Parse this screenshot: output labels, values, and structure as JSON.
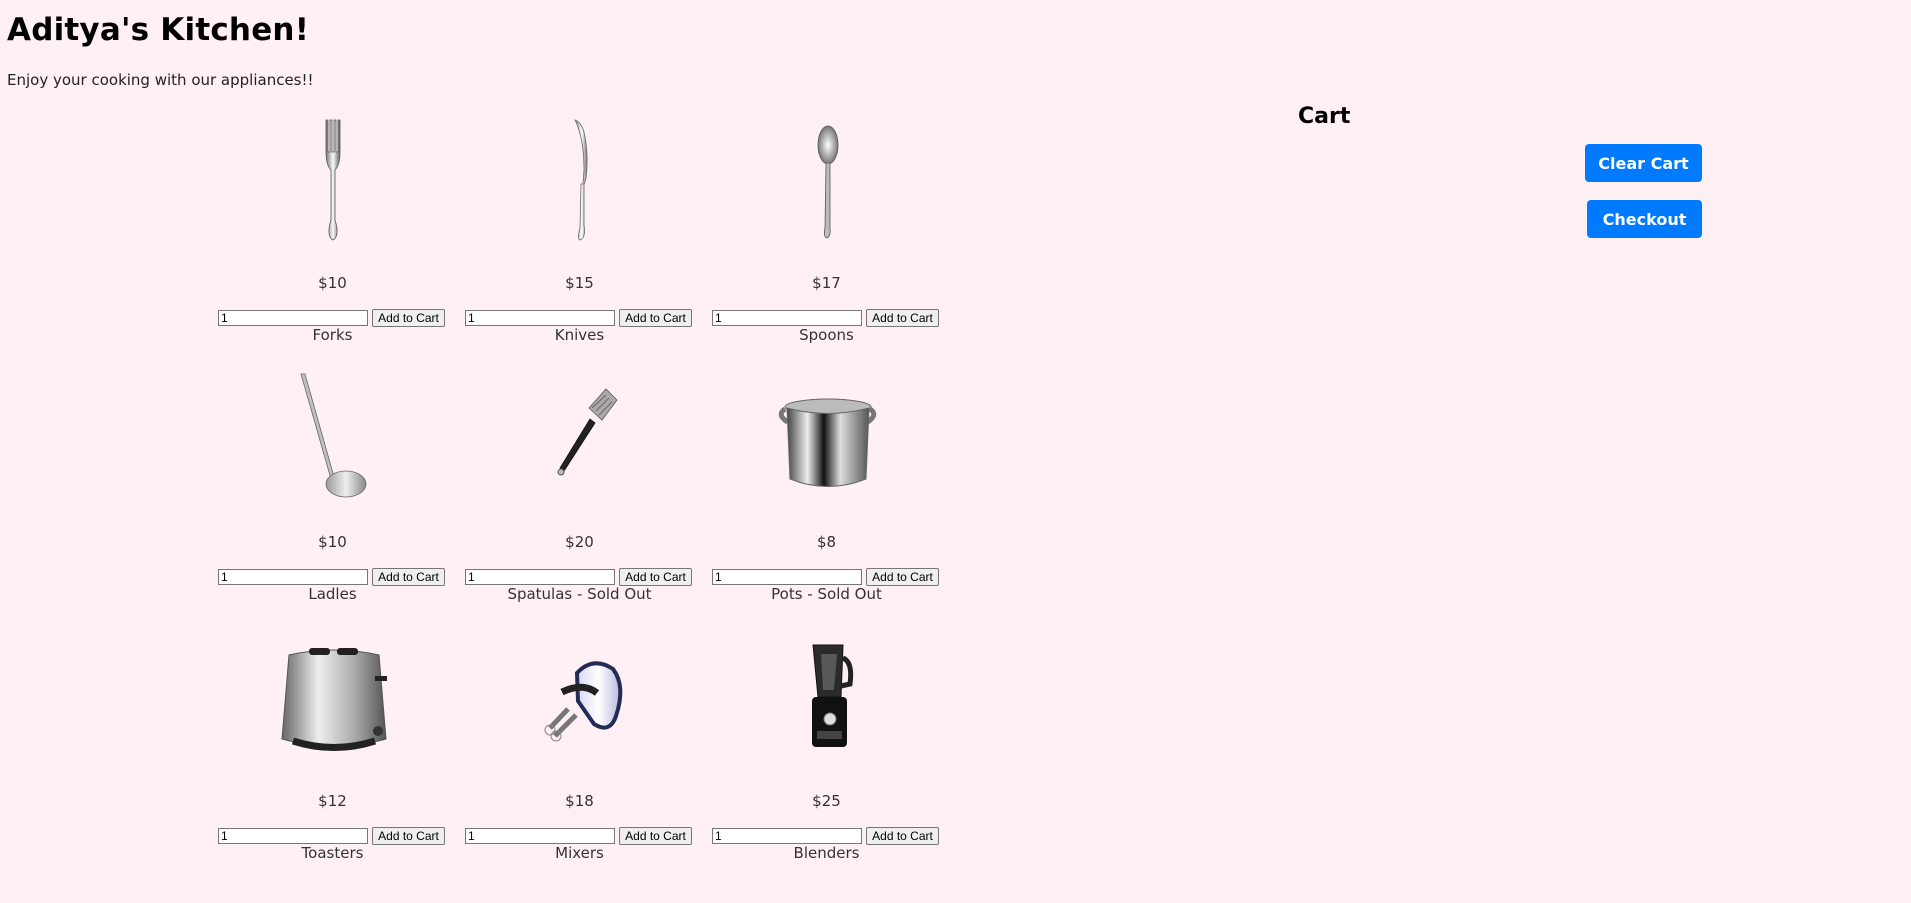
{
  "header": {
    "title": "Aditya's Kitchen!",
    "subtitle": "Enjoy your cooking with our appliances!!"
  },
  "products": [
    {
      "name": "Forks",
      "price": "$10",
      "quantity": "1",
      "button_label": "Add to Cart",
      "icon": "fork-icon"
    },
    {
      "name": "Knives",
      "price": "$15",
      "quantity": "1",
      "button_label": "Add to Cart",
      "icon": "knife-icon"
    },
    {
      "name": "Spoons",
      "price": "$17",
      "quantity": "1",
      "button_label": "Add to Cart",
      "icon": "spoon-icon"
    },
    {
      "name": "Ladles",
      "price": "$10",
      "quantity": "1",
      "button_label": "Add to Cart",
      "icon": "ladle-icon"
    },
    {
      "name": "Spatulas - Sold Out",
      "price": "$20",
      "quantity": "1",
      "button_label": "Add to Cart",
      "icon": "spatula-icon"
    },
    {
      "name": "Pots - Sold Out",
      "price": "$8",
      "quantity": "1",
      "button_label": "Add to Cart",
      "icon": "pot-icon"
    },
    {
      "name": "Toasters",
      "price": "$12",
      "quantity": "1",
      "button_label": "Add to Cart",
      "icon": "toaster-icon"
    },
    {
      "name": "Mixers",
      "price": "$18",
      "quantity": "1",
      "button_label": "Add to Cart",
      "icon": "mixer-icon"
    },
    {
      "name": "Blenders",
      "price": "$25",
      "quantity": "1",
      "button_label": "Add to Cart",
      "icon": "blender-icon"
    }
  ],
  "cart": {
    "heading": "Cart",
    "clear_label": "Clear Cart",
    "checkout_label": "Checkout"
  },
  "colors": {
    "background": "#fff0f5",
    "primary_button": "#007bff"
  }
}
